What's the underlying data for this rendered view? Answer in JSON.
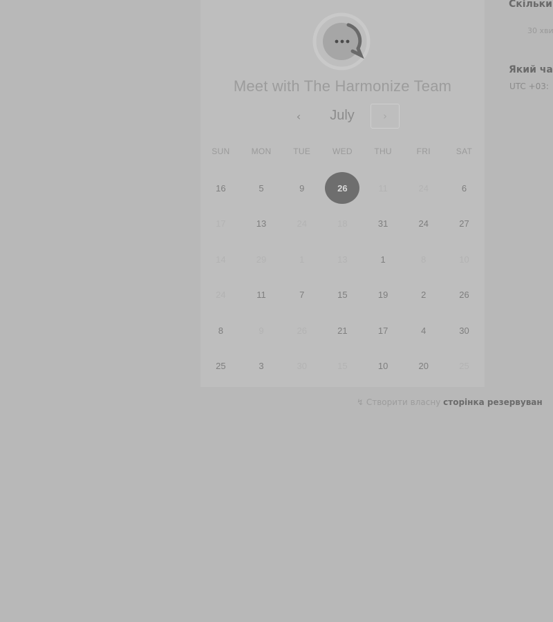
{
  "header": {
    "title": "Meet with The Harmonize Team",
    "logo_icon": "chat-bubble-icon"
  },
  "calendar": {
    "month": "July",
    "prev_icon": "‹",
    "next_icon": "›",
    "weekdays": [
      "SUN",
      "MON",
      "TUE",
      "WED",
      "THU",
      "FRI",
      "SAT"
    ],
    "weeks": [
      [
        {
          "d": "16",
          "s": "avail"
        },
        {
          "d": "5",
          "s": "avail"
        },
        {
          "d": "9",
          "s": "avail"
        },
        {
          "d": "26",
          "s": "selected"
        },
        {
          "d": "11",
          "s": "off"
        },
        {
          "d": "24",
          "s": "off"
        },
        {
          "d": "6",
          "s": "avail"
        }
      ],
      [
        {
          "d": "17",
          "s": "off"
        },
        {
          "d": "13",
          "s": "avail"
        },
        {
          "d": "24",
          "s": "off"
        },
        {
          "d": "18",
          "s": "off"
        },
        {
          "d": "31",
          "s": "avail"
        },
        {
          "d": "24",
          "s": "avail"
        },
        {
          "d": "27",
          "s": "avail"
        }
      ],
      [
        {
          "d": "14",
          "s": "off"
        },
        {
          "d": "29",
          "s": "off"
        },
        {
          "d": "1",
          "s": "off"
        },
        {
          "d": "13",
          "s": "off"
        },
        {
          "d": "1",
          "s": "avail"
        },
        {
          "d": "8",
          "s": "off"
        },
        {
          "d": "10",
          "s": "off"
        }
      ],
      [
        {
          "d": "24",
          "s": "off"
        },
        {
          "d": "11",
          "s": "avail"
        },
        {
          "d": "7",
          "s": "avail"
        },
        {
          "d": "15",
          "s": "avail"
        },
        {
          "d": "19",
          "s": "avail"
        },
        {
          "d": "2",
          "s": "avail"
        },
        {
          "d": "26",
          "s": "avail"
        }
      ],
      [
        {
          "d": "8",
          "s": "avail"
        },
        {
          "d": "9",
          "s": "off"
        },
        {
          "d": "26",
          "s": "off"
        },
        {
          "d": "21",
          "s": "avail"
        },
        {
          "d": "17",
          "s": "avail"
        },
        {
          "d": "4",
          "s": "avail"
        },
        {
          "d": "30",
          "s": "avail"
        }
      ],
      [
        {
          "d": "25",
          "s": "avail"
        },
        {
          "d": "3",
          "s": "avail"
        },
        {
          "d": "30",
          "s": "off"
        },
        {
          "d": "15",
          "s": "off"
        },
        {
          "d": "10",
          "s": "avail"
        },
        {
          "d": "20",
          "s": "avail"
        },
        {
          "d": "25",
          "s": "off"
        }
      ]
    ]
  },
  "side_panel": {
    "duration_question": "Скільки",
    "duration_value": "30 хви",
    "time_question": "Який ча",
    "timezone": "UTC +03:"
  },
  "footer": {
    "prefix": "↯ Створити власну",
    "link": "сторінка резервуван"
  },
  "colors": {
    "background": "#b8b8b8",
    "card": "#bebebe",
    "selected_day": "#6e6e6e"
  }
}
